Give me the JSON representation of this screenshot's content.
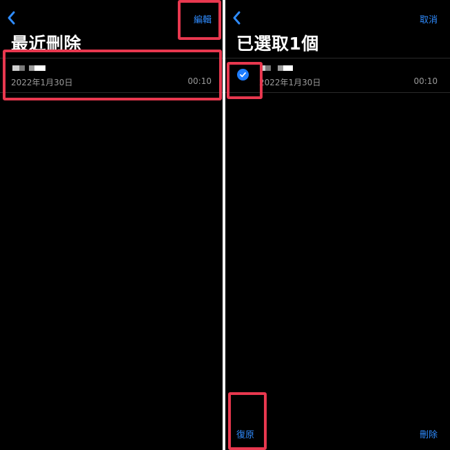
{
  "left": {
    "nav": {
      "action_label": "編輯"
    },
    "title": "最近刪除",
    "row": {
      "date": "2022年1月30日",
      "duration": "00:10"
    }
  },
  "right": {
    "nav": {
      "action_label": "取消"
    },
    "title": "已選取1個",
    "row": {
      "date": "2022年1月30日",
      "duration": "00:10",
      "selected": true
    },
    "toolbar": {
      "restore_label": "復原",
      "delete_label": "刪除"
    }
  },
  "colors": {
    "accent": "#2f8cff",
    "highlight": "#e8384f",
    "background": "#000000"
  },
  "icons": {
    "back": "chevron-left-icon",
    "check": "checkmark-circle-icon"
  }
}
